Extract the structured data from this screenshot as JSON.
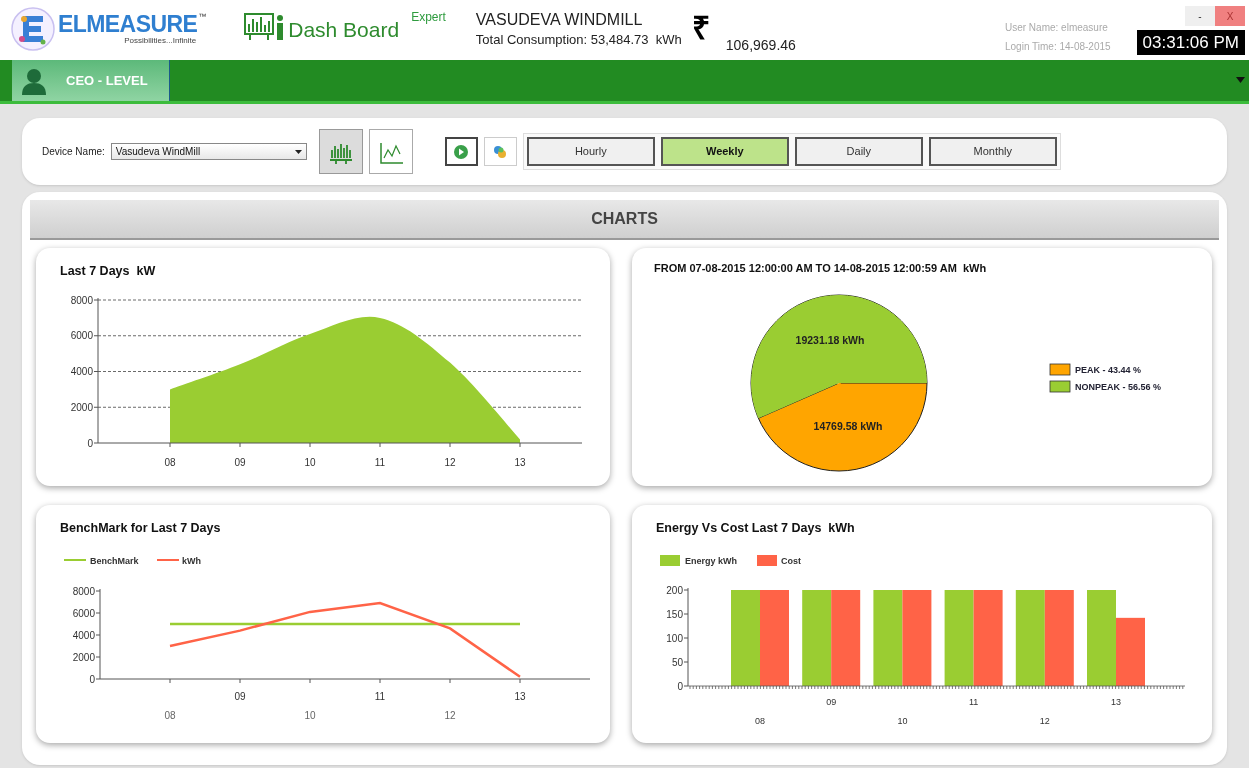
{
  "header": {
    "brand": "ELMEASURE",
    "trademark": "™",
    "tagline": "Possibilities...Infinite",
    "app_name": "Dash Board",
    "edition": "Expert",
    "site": "VASUDEVA WINDMILL",
    "consumption": "Total Consumption: 53,484.73  kWh",
    "currency_symbol": "₹",
    "cost": "106,969.46",
    "user_name": "User Name: elmeasure",
    "login_time": "Login Time: 14-08-2015",
    "window_buttons": [
      {
        "kind": "minimize",
        "label": "-"
      },
      {
        "kind": "close",
        "label": "X"
      }
    ],
    "clock": "03:31:06 PM"
  },
  "nav": {
    "tabs": [
      {
        "label": "CEO - LEVEL",
        "selected": true
      }
    ]
  },
  "toolbar": {
    "device_label": "Device Name:",
    "device_value": "Vasudeva WindMill",
    "view_buttons": [
      {
        "kind": "bar",
        "selected": true
      },
      {
        "kind": "line",
        "selected": false
      }
    ],
    "actions": [
      {
        "kind": "play"
      },
      {
        "kind": "link"
      }
    ],
    "periods": [
      {
        "label": "Hourly",
        "selected": false
      },
      {
        "label": "Weekly",
        "selected": true
      },
      {
        "label": "Daily",
        "selected": false
      },
      {
        "label": "Monthly",
        "selected": false
      }
    ]
  },
  "charts_header": "CHARTS",
  "charts": [
    {
      "chart_data": {
        "type": "area",
        "title": "Last 7 Days  kW",
        "categories": [
          "08",
          "09",
          "10",
          "11",
          "12",
          "13"
        ],
        "series": [
          {
            "color": "#9acd32",
            "values": [
              3000,
              4400,
              6100,
              7000,
              4500,
              200
            ]
          }
        ],
        "grid": true,
        "ylim": [
          0,
          8000
        ],
        "yticks": [
          0,
          2000,
          4000,
          6000,
          8000
        ]
      }
    },
    {
      "chart_data": {
        "type": "pie",
        "title": "FROM 07-08-2015 12:00:00 AM TO 14-08-2015 12:00:59 AM  kWh",
        "categories": [
          "PEAK - 43.44 %",
          "NONPEAK - 56.56 %"
        ],
        "series": [
          {
            "colors": [
              "#ffa500",
              "#9acd32"
            ],
            "values": [
              43.44,
              56.56
            ]
          }
        ],
        "legend": true,
        "value_labels": [
          "14769.58 kWh",
          "19231.18 kWh"
        ]
      }
    },
    {
      "chart_data": {
        "type": "line",
        "title": "BenchMark for Last 7 Days",
        "categories": [
          "08",
          "09",
          "10",
          "11",
          "12",
          "13"
        ],
        "series": [
          {
            "name": "BenchMark",
            "color": "#9acd32",
            "values": [
              5000,
              5000,
              5000,
              5000,
              5000,
              5000
            ]
          },
          {
            "name": "kWh",
            "color": "#ff6347",
            "values": [
              3000,
              4400,
              6100,
              6900,
              4600,
              200
            ]
          }
        ],
        "legend": true,
        "ylim": [
          0,
          8000
        ],
        "yticks": [
          0,
          2000,
          4000,
          6000,
          8000
        ]
      }
    },
    {
      "chart_data": {
        "type": "bar",
        "title": "Energy Vs Cost Last 7 Days  kWh",
        "categories": [
          "08",
          "09",
          "10",
          "11",
          "12",
          "13"
        ],
        "series": [
          {
            "name": "Energy kWh",
            "color": "#9acd32",
            "values": [
              200,
              200,
              200,
              200,
              200,
              200
            ]
          },
          {
            "name": "Cost",
            "color": "#ff6347",
            "values": [
              200,
              200,
              200,
              200,
              200,
              142
            ]
          }
        ],
        "legend": true,
        "ylim": [
          0,
          200
        ],
        "yticks": [
          0,
          50,
          100,
          150,
          200
        ]
      }
    }
  ]
}
